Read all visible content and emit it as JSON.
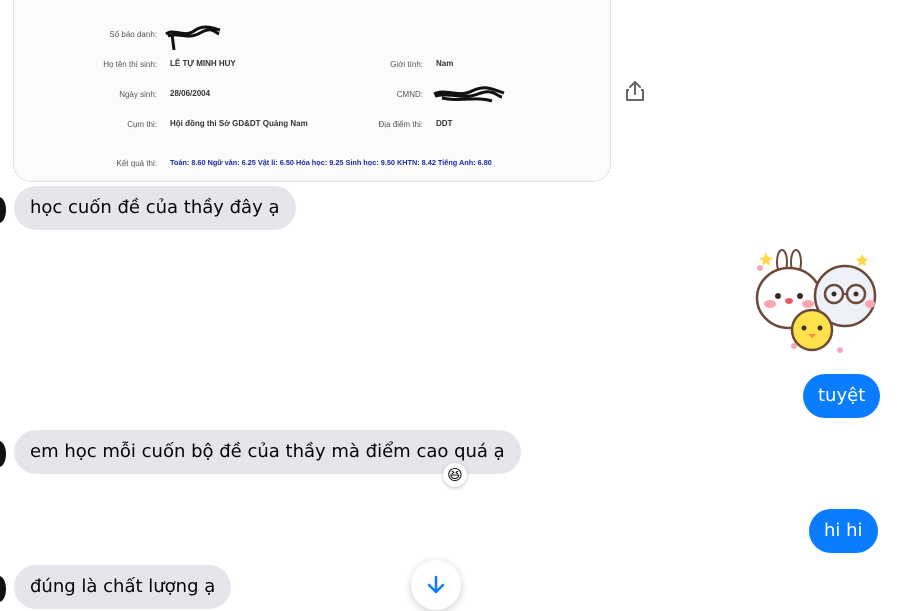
{
  "card": {
    "so_bao_danh_label": "Số báo danh:",
    "ho_ten_label": "Họ tên thí sinh:",
    "ho_ten_value": "LÊ TỰ MINH HUY",
    "gioi_tinh_label": "Giới tính:",
    "gioi_tinh_value": "Nam",
    "ngay_sinh_label": "Ngày sinh:",
    "ngay_sinh_value": "28/06/2004",
    "cmnd_label": "CMND:",
    "cum_thi_label": "Cụm thi:",
    "cum_thi_value": "Hội đồng thi Sở GD&DT Quảng Nam",
    "dia_diem_label": "Địa điểm thi:",
    "dia_diem_value": "DDT",
    "ket_qua_label": "Kết quả thi:",
    "ket_qua_value": "Toán: 8.60 Ngữ văn: 6.25 Vật lí: 6.50 Hóa học: 9.25 Sinh học: 9.50 KHTN: 8.42 Tiếng Anh: 6.80"
  },
  "messages": {
    "incoming_1": "học cuốn đề của thầy đây ạ",
    "outgoing_1": "tuyệt",
    "incoming_2": "em học mỗi cuốn bộ đề của thầy mà điểm cao quá ạ",
    "outgoing_2": "hi hi",
    "incoming_3": "đúng là chất lượng ạ"
  },
  "reaction_emoji": "😆",
  "icons": [
    "share-icon",
    "scroll-down-arrow-icon",
    "sticker-image"
  ],
  "colors": {
    "outgoing_bubble": "#0a7cff",
    "incoming_bubble": "#e4e6eb",
    "score_text": "#1c2aa8"
  }
}
